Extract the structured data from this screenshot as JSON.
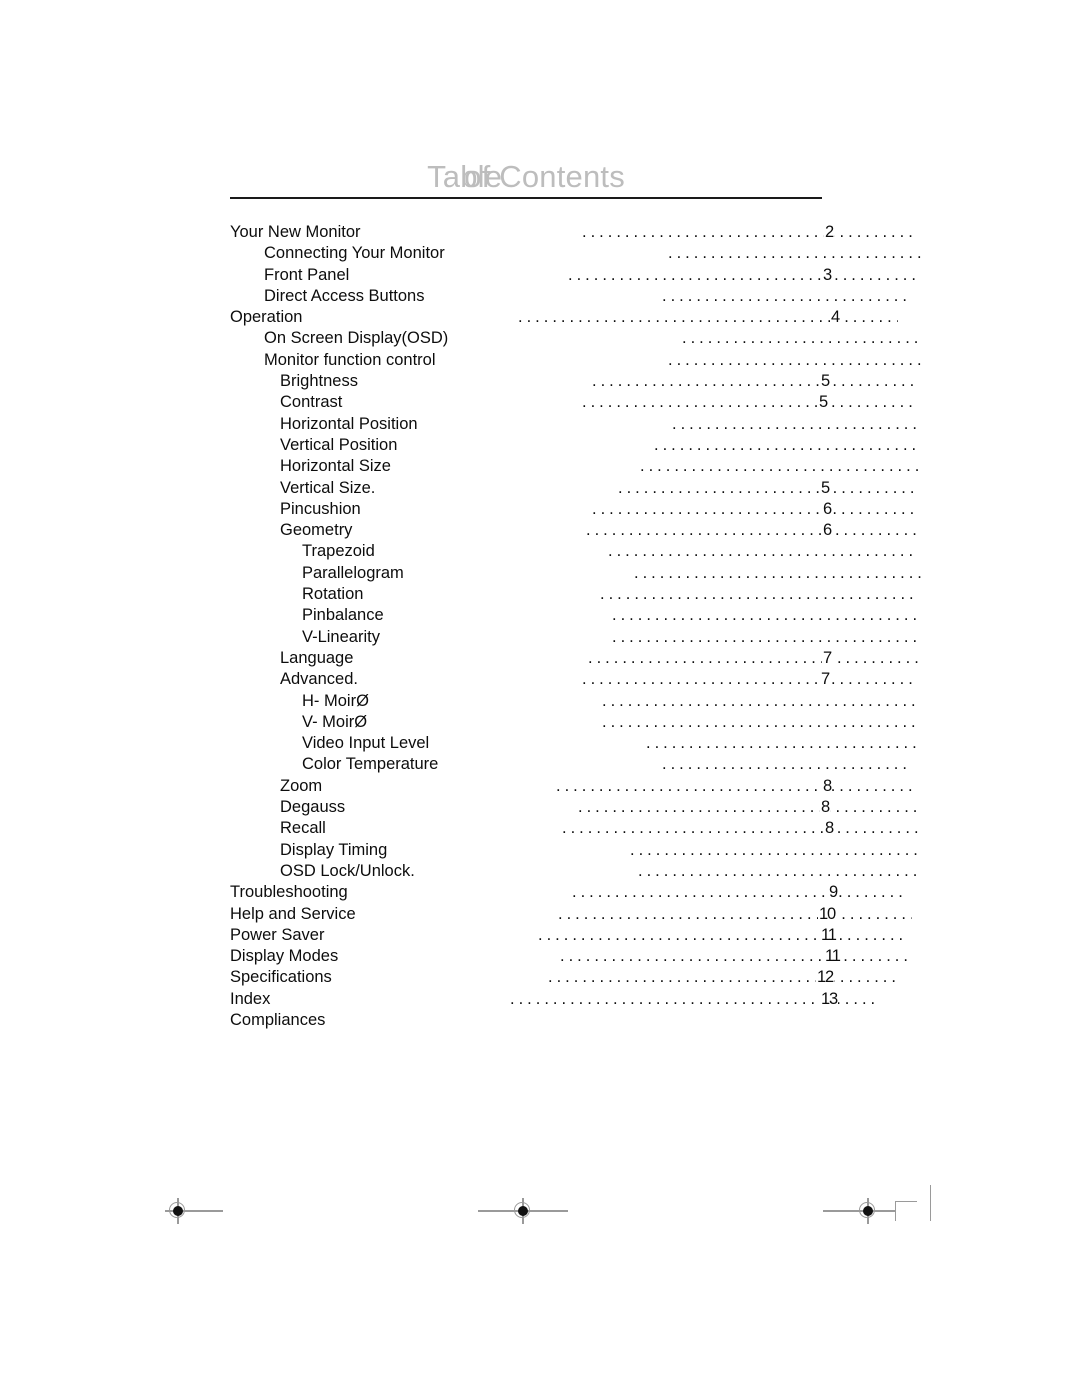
{
  "document": {
    "title_primary": "Table",
    "title_secondary": "of Contents",
    "title_overlay_a": "Table",
    "title_overlay_b": "of Contents",
    "title_color": "#bdbdbd",
    "rule_color": "#1a1a1a",
    "text_color": "#0d0d0d"
  },
  "toc": {
    "entries": [
      {
        "label": "Your New Monitor",
        "level": 0,
        "page": "2",
        "leader_start": 352,
        "pagenum_x": 594,
        "leader_end": 686
      },
      {
        "label": "Connecting Your Monitor",
        "level": 1,
        "page": "",
        "leader_start": 438,
        "pagenum_x": 0,
        "leader_end": 692
      },
      {
        "label": "Front Panel",
        "level": 1,
        "page": "3",
        "leader_start": 338,
        "pagenum_x": 592,
        "leader_end": 688
      },
      {
        "label": "Direct Access Buttons",
        "level": 1,
        "page": "",
        "leader_start": 432,
        "pagenum_x": 0,
        "leader_end": 682
      },
      {
        "label": "Operation",
        "level": 0,
        "page": "4",
        "leader_start": 288,
        "pagenum_x": 600,
        "leader_end": 668
      },
      {
        "label": "On Screen Display(OSD)",
        "level": 1,
        "page": "",
        "leader_start": 452,
        "pagenum_x": 0,
        "leader_end": 688
      },
      {
        "label": "Monitor function control",
        "level": 1,
        "page": "",
        "leader_start": 438,
        "pagenum_x": 0,
        "leader_end": 692
      },
      {
        "label": "Brightness",
        "level": 2,
        "page": "5",
        "leader_start": 362,
        "pagenum_x": 590,
        "leader_end": 688
      },
      {
        "label": "Contrast",
        "level": 2,
        "page": "5",
        "leader_start": 352,
        "pagenum_x": 588,
        "leader_end": 688
      },
      {
        "label": "Horizontal Position",
        "level": 2,
        "page": "",
        "leader_start": 442,
        "pagenum_x": 0,
        "leader_end": 688
      },
      {
        "label": "Vertical Position",
        "level": 2,
        "page": "",
        "leader_start": 424,
        "pagenum_x": 0,
        "leader_end": 688
      },
      {
        "label": "Horizontal Size",
        "level": 2,
        "page": "",
        "leader_start": 410,
        "pagenum_x": 0,
        "leader_end": 688
      },
      {
        "label": "Vertical Size.",
        "level": 2,
        "page": "5",
        "leader_start": 388,
        "pagenum_x": 590,
        "leader_end": 688
      },
      {
        "label": "Pincushion",
        "level": 2,
        "page": "6",
        "leader_start": 362,
        "pagenum_x": 592,
        "leader_end": 688
      },
      {
        "label": "Geometry",
        "level": 2,
        "page": "6",
        "leader_start": 356,
        "pagenum_x": 592,
        "leader_end": 688
      },
      {
        "label": "Trapezoid",
        "level": 3,
        "page": "",
        "leader_start": 378,
        "pagenum_x": 0,
        "leader_end": 688
      },
      {
        "label": "Parallelogram",
        "level": 3,
        "page": "",
        "leader_start": 404,
        "pagenum_x": 0,
        "leader_end": 692
      },
      {
        "label": "Rotation",
        "level": 3,
        "page": "",
        "leader_start": 370,
        "pagenum_x": 0,
        "leader_end": 688
      },
      {
        "label": "Pinbalance",
        "level": 3,
        "page": "",
        "leader_start": 382,
        "pagenum_x": 0,
        "leader_end": 688
      },
      {
        "label": "V-Linearity",
        "level": 3,
        "page": "",
        "leader_start": 382,
        "pagenum_x": 0,
        "leader_end": 692
      },
      {
        "label": "Language",
        "level": 2,
        "page": "7",
        "leader_start": 358,
        "pagenum_x": 592,
        "leader_end": 688
      },
      {
        "label": "Advanced.",
        "level": 2,
        "page": "7",
        "leader_start": 352,
        "pagenum_x": 590,
        "leader_end": 688
      },
      {
        "label": "H- MoirØ",
        "level": 3,
        "page": "",
        "leader_start": 372,
        "pagenum_x": 0,
        "leader_end": 688
      },
      {
        "label": "V- MoirØ",
        "level": 3,
        "page": "",
        "leader_start": 372,
        "pagenum_x": 0,
        "leader_end": 688
      },
      {
        "label": "Video Input Level",
        "level": 3,
        "page": "",
        "leader_start": 416,
        "pagenum_x": 0,
        "leader_end": 688
      },
      {
        "label": "Color Temperature",
        "level": 3,
        "page": "",
        "leader_start": 432,
        "pagenum_x": 0,
        "leader_end": 682
      },
      {
        "label": "Zoom",
        "level": 2,
        "page": "8",
        "leader_start": 326,
        "pagenum_x": 592,
        "leader_end": 688
      },
      {
        "label": "Degauss",
        "level": 2,
        "page": "8",
        "leader_start": 348,
        "pagenum_x": 590,
        "leader_end": 688
      },
      {
        "label": "Recall",
        "level": 2,
        "page": "8",
        "leader_start": 332,
        "pagenum_x": 594,
        "leader_end": 688
      },
      {
        "label": "Display Timing",
        "level": 2,
        "page": "",
        "leader_start": 400,
        "pagenum_x": 0,
        "leader_end": 688
      },
      {
        "label": "OSD Lock/Unlock.",
        "level": 2,
        "page": "",
        "leader_start": 408,
        "pagenum_x": 0,
        "leader_end": 688
      },
      {
        "label": "Troubleshooting",
        "level": 0,
        "page": "9",
        "leader_start": 342,
        "pagenum_x": 598,
        "leader_end": 678
      },
      {
        "label": "Help and Service",
        "level": 0,
        "page": "10",
        "leader_start": 328,
        "pagenum_x": 588,
        "leader_end": 682
      },
      {
        "label": "Power Saver",
        "level": 0,
        "page": "11",
        "leader_start": 308,
        "pagenum_x": 590,
        "leader_end": 672
      },
      {
        "label": "Display Modes",
        "level": 0,
        "page": "11",
        "leader_start": 330,
        "pagenum_x": 594,
        "leader_end": 682
      },
      {
        "label": "Specifications",
        "level": 0,
        "page": "12",
        "leader_start": 318,
        "pagenum_x": 586,
        "leader_end": 668
      },
      {
        "label": "Index",
        "level": 0,
        "page": "13",
        "leader_start": 280,
        "pagenum_x": 590,
        "leader_end": 650
      },
      {
        "label": "Compliances",
        "level": 0,
        "page": "",
        "leader_start": 0,
        "pagenum_x": 0,
        "leader_end": 0
      }
    ]
  },
  "print_marks": {
    "registration_left": "registration-mark",
    "registration_center": "registration-mark",
    "registration_right": "registration-mark",
    "crop_corner": "crop-mark"
  }
}
